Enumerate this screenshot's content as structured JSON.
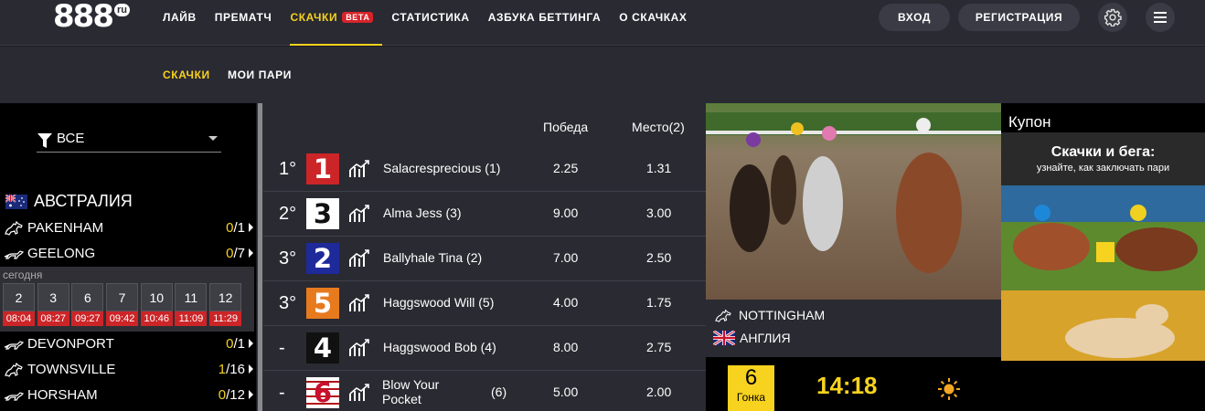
{
  "header": {
    "logo_digits": "888",
    "logo_suffix": "ru",
    "nav": [
      {
        "label": "ЛАЙВ"
      },
      {
        "label": "ПРЕМАТЧ"
      },
      {
        "label": "СКАЧКИ",
        "badge": "BETA",
        "active": true
      },
      {
        "label": "СТАТИСТИКА"
      },
      {
        "label": "АЗБУКА БЕТТИНГА"
      },
      {
        "label": "О СКАЧКАХ"
      }
    ],
    "login_label": "ВХОД",
    "register_label": "РЕГИСТРАЦИЯ",
    "accent_color": "#f7d21e"
  },
  "subnav": {
    "races_label": "СКАЧКИ",
    "bets_label": "МОИ ПАРИ"
  },
  "sidebar": {
    "filter_value": "ВСЕ",
    "country": "АВСТРАЛИЯ",
    "tracks_top": [
      {
        "name": "PAKENHAM",
        "done": "0",
        "total": "/1"
      },
      {
        "name": "GEELONG",
        "done": "0",
        "total": "/7"
      }
    ],
    "today_label": "сегодня",
    "races": [
      {
        "num": "2",
        "time": "08:04"
      },
      {
        "num": "3",
        "time": "08:27"
      },
      {
        "num": "6",
        "time": "09:27"
      },
      {
        "num": "7",
        "time": "09:42"
      },
      {
        "num": "10",
        "time": "10:46"
      },
      {
        "num": "11",
        "time": "11:09"
      },
      {
        "num": "12",
        "time": "11:29"
      }
    ],
    "tracks_bottom": [
      {
        "name": "DEVONPORT",
        "done": "0",
        "total": "/1"
      },
      {
        "name": "TOWNSVILLE",
        "done": "1",
        "total": "/16"
      },
      {
        "name": "HORSHAM",
        "done": "0",
        "total": "/12"
      }
    ]
  },
  "results": {
    "col_win": "Победа",
    "col_place": "Место(2)",
    "rows": [
      {
        "pos": "1°",
        "saddle": "1",
        "name": "Salacresprecious (1)",
        "num": "",
        "win": "2.25",
        "place": "1.31"
      },
      {
        "pos": "2°",
        "saddle": "3",
        "name": "Alma Jess (3)",
        "num": "",
        "win": "9.00",
        "place": "3.00"
      },
      {
        "pos": "3°",
        "saddle": "2",
        "name": "Ballyhale Tina (2)",
        "num": "",
        "win": "7.00",
        "place": "2.50"
      },
      {
        "pos": "3°",
        "saddle": "5",
        "name": "Haggswood Will (5)",
        "num": "",
        "win": "4.00",
        "place": "1.75"
      },
      {
        "pos": "-",
        "saddle": "4",
        "name": "Haggswood Bob (4)",
        "num": "",
        "win": "8.00",
        "place": "2.75"
      },
      {
        "pos": "-",
        "saddle": "6",
        "name": "Blow Your Pocket",
        "num": "(6)",
        "win": "5.00",
        "place": "2.00"
      }
    ],
    "saddle_colors": [
      "#cc2528",
      "#ffffff",
      "#1e2a9a",
      "#e87a1e",
      "#111111",
      "#ffffff"
    ]
  },
  "venue": {
    "track": "NOTTINGHAM",
    "country": "АНГЛИЯ"
  },
  "race_info": {
    "number": "6",
    "label": "Гонка",
    "time": "14:18"
  },
  "coupon": {
    "title": "Купон",
    "banner_title": "Скачки и бега:",
    "banner_sub": "узнайте, как заключать пари"
  }
}
